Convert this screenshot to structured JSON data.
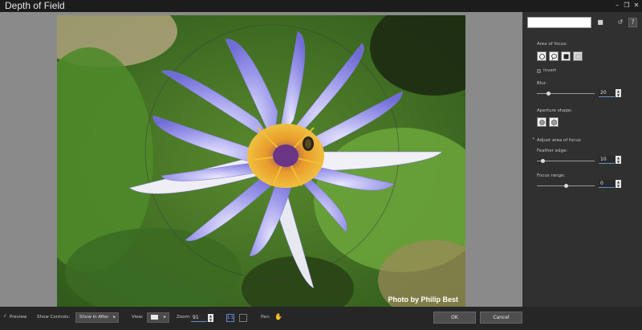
{
  "window": {
    "title": "Depth of Field",
    "restore_glyph": "❐",
    "close_glyph": "✕"
  },
  "photo": {
    "credit": "Photo by Philip Best"
  },
  "panel": {
    "area_of_focus_label": "Area of focus:",
    "invert_label": "Invert",
    "blur_label": "Blur:",
    "blur_value": "20",
    "blur_fraction": 0.2,
    "aperture_label": "Aperture shape:",
    "adjust_label": "Adjust area of focus",
    "feather_label": "Feather edge:",
    "feather_value": "10",
    "feather_fraction": 0.1,
    "focus_range_label": "Focus range:",
    "focus_range_value": "0",
    "focus_range_fraction": 0.5,
    "spin_up": "▲",
    "spin_down": "▼",
    "help_glyph": "?",
    "reset_glyph": "↺",
    "save_glyph": "■"
  },
  "bottom": {
    "preview_label": "Preview",
    "show_controls_label": "Show Controls:",
    "show_in_after": "Show in After",
    "view_label": "View:",
    "zoom_label": "Zoom:",
    "zoom_value": "91",
    "pan_label": "Pan:",
    "ok_label": "OK",
    "cancel_label": "Cancel",
    "arrow": "▸"
  }
}
